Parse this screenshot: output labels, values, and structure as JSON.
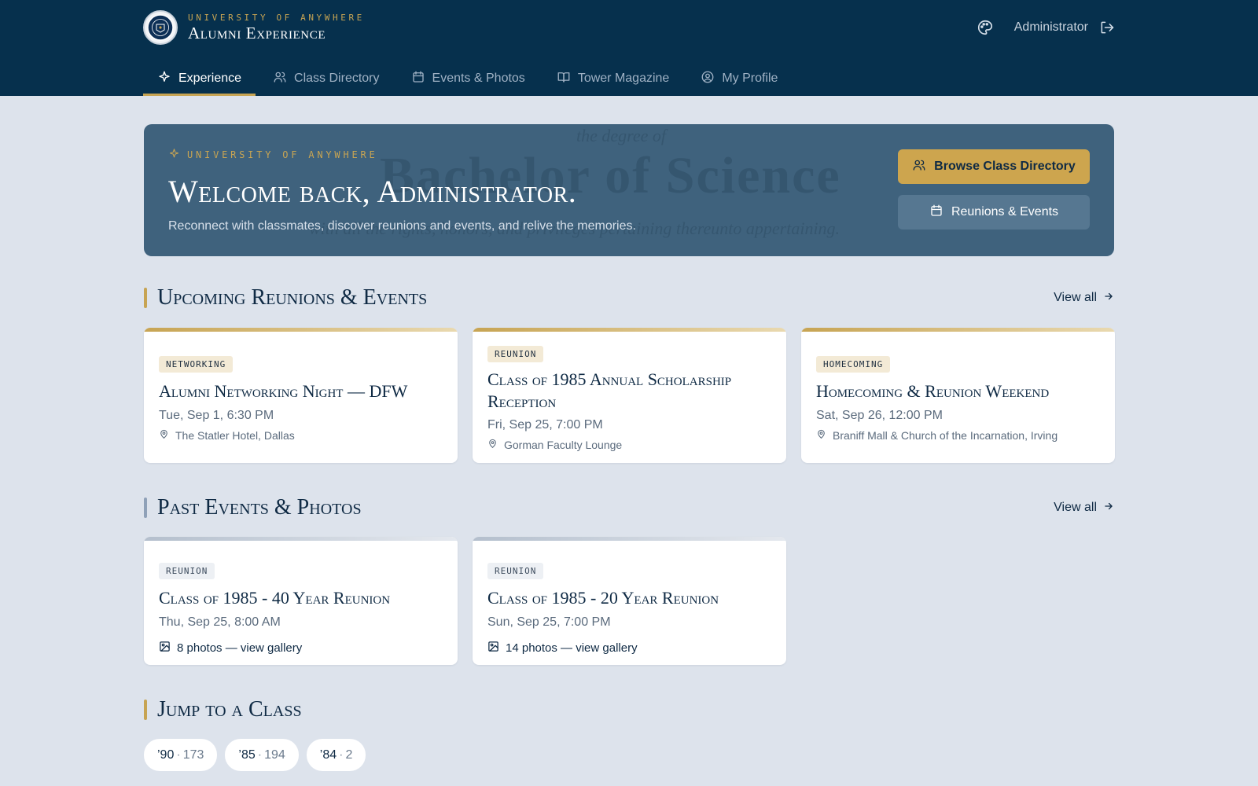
{
  "brand": {
    "kicker": "University of Anywhere",
    "title": "Alumni Experience",
    "seal": "university-seal"
  },
  "header": {
    "theme_icon": "palette-icon",
    "user_name": "Administrator",
    "logout_icon": "logout-icon"
  },
  "nav": [
    {
      "label": "Experience",
      "icon": "sparkle-icon",
      "active": true
    },
    {
      "label": "Class Directory",
      "icon": "users-icon",
      "active": false
    },
    {
      "label": "Events & Photos",
      "icon": "calendar-icon",
      "active": false
    },
    {
      "label": "Tower Magazine",
      "icon": "book-icon",
      "active": false
    },
    {
      "label": "My Profile",
      "icon": "user-circle-icon",
      "active": false
    }
  ],
  "hero": {
    "kicker": "University of Anywhere",
    "title": "Welcome back, Administrator.",
    "subtitle": "Reconnect with classmates, discover reunions and events, and relive the memories.",
    "watermark_line1": "the degree of",
    "watermark_line2": "Bachelor of Science",
    "watermark_line3": "with all the rights, honors, and privileges pertaining thereunto appertaining.",
    "primary_button": "Browse Class Directory",
    "secondary_button": "Reunions & Events"
  },
  "upcoming": {
    "title": "Upcoming Reunions & Events",
    "view_all": "View all",
    "events": [
      {
        "tag": "Networking",
        "title": "Alumni Networking Night — DFW",
        "date": "Tue, Sep 1, 6:30 PM",
        "location": "The Statler Hotel, Dallas"
      },
      {
        "tag": "Reunion",
        "title": "Class of 1985 Annual Scholarship Reception",
        "date": "Fri, Sep 25, 7:00 PM",
        "location": "Gorman Faculty Lounge"
      },
      {
        "tag": "Homecoming",
        "title": "Homecoming & Reunion Weekend",
        "date": "Sat, Sep 26, 12:00 PM",
        "location": "Braniff Mall & Church of the Incarnation, Irving"
      }
    ]
  },
  "past": {
    "title": "Past Events & Photos",
    "view_all": "View all",
    "events": [
      {
        "tag": "Reunion",
        "title": "Class of 1985 - 40 Year Reunion",
        "date": "Thu, Sep 25, 8:00 AM",
        "photos": "8 photos — view gallery"
      },
      {
        "tag": "Reunion",
        "title": "Class of 1985 - 20 Year Reunion",
        "date": "Sun, Sep 25, 7:00 PM",
        "photos": "14 photos — view gallery"
      }
    ]
  },
  "jump": {
    "title": "Jump to a Class",
    "classes": [
      {
        "year": "’90",
        "sep": "·",
        "count": "173"
      },
      {
        "year": "’85",
        "sep": "·",
        "count": "194"
      },
      {
        "year": "’84",
        "sep": "·",
        "count": "2"
      }
    ]
  }
}
